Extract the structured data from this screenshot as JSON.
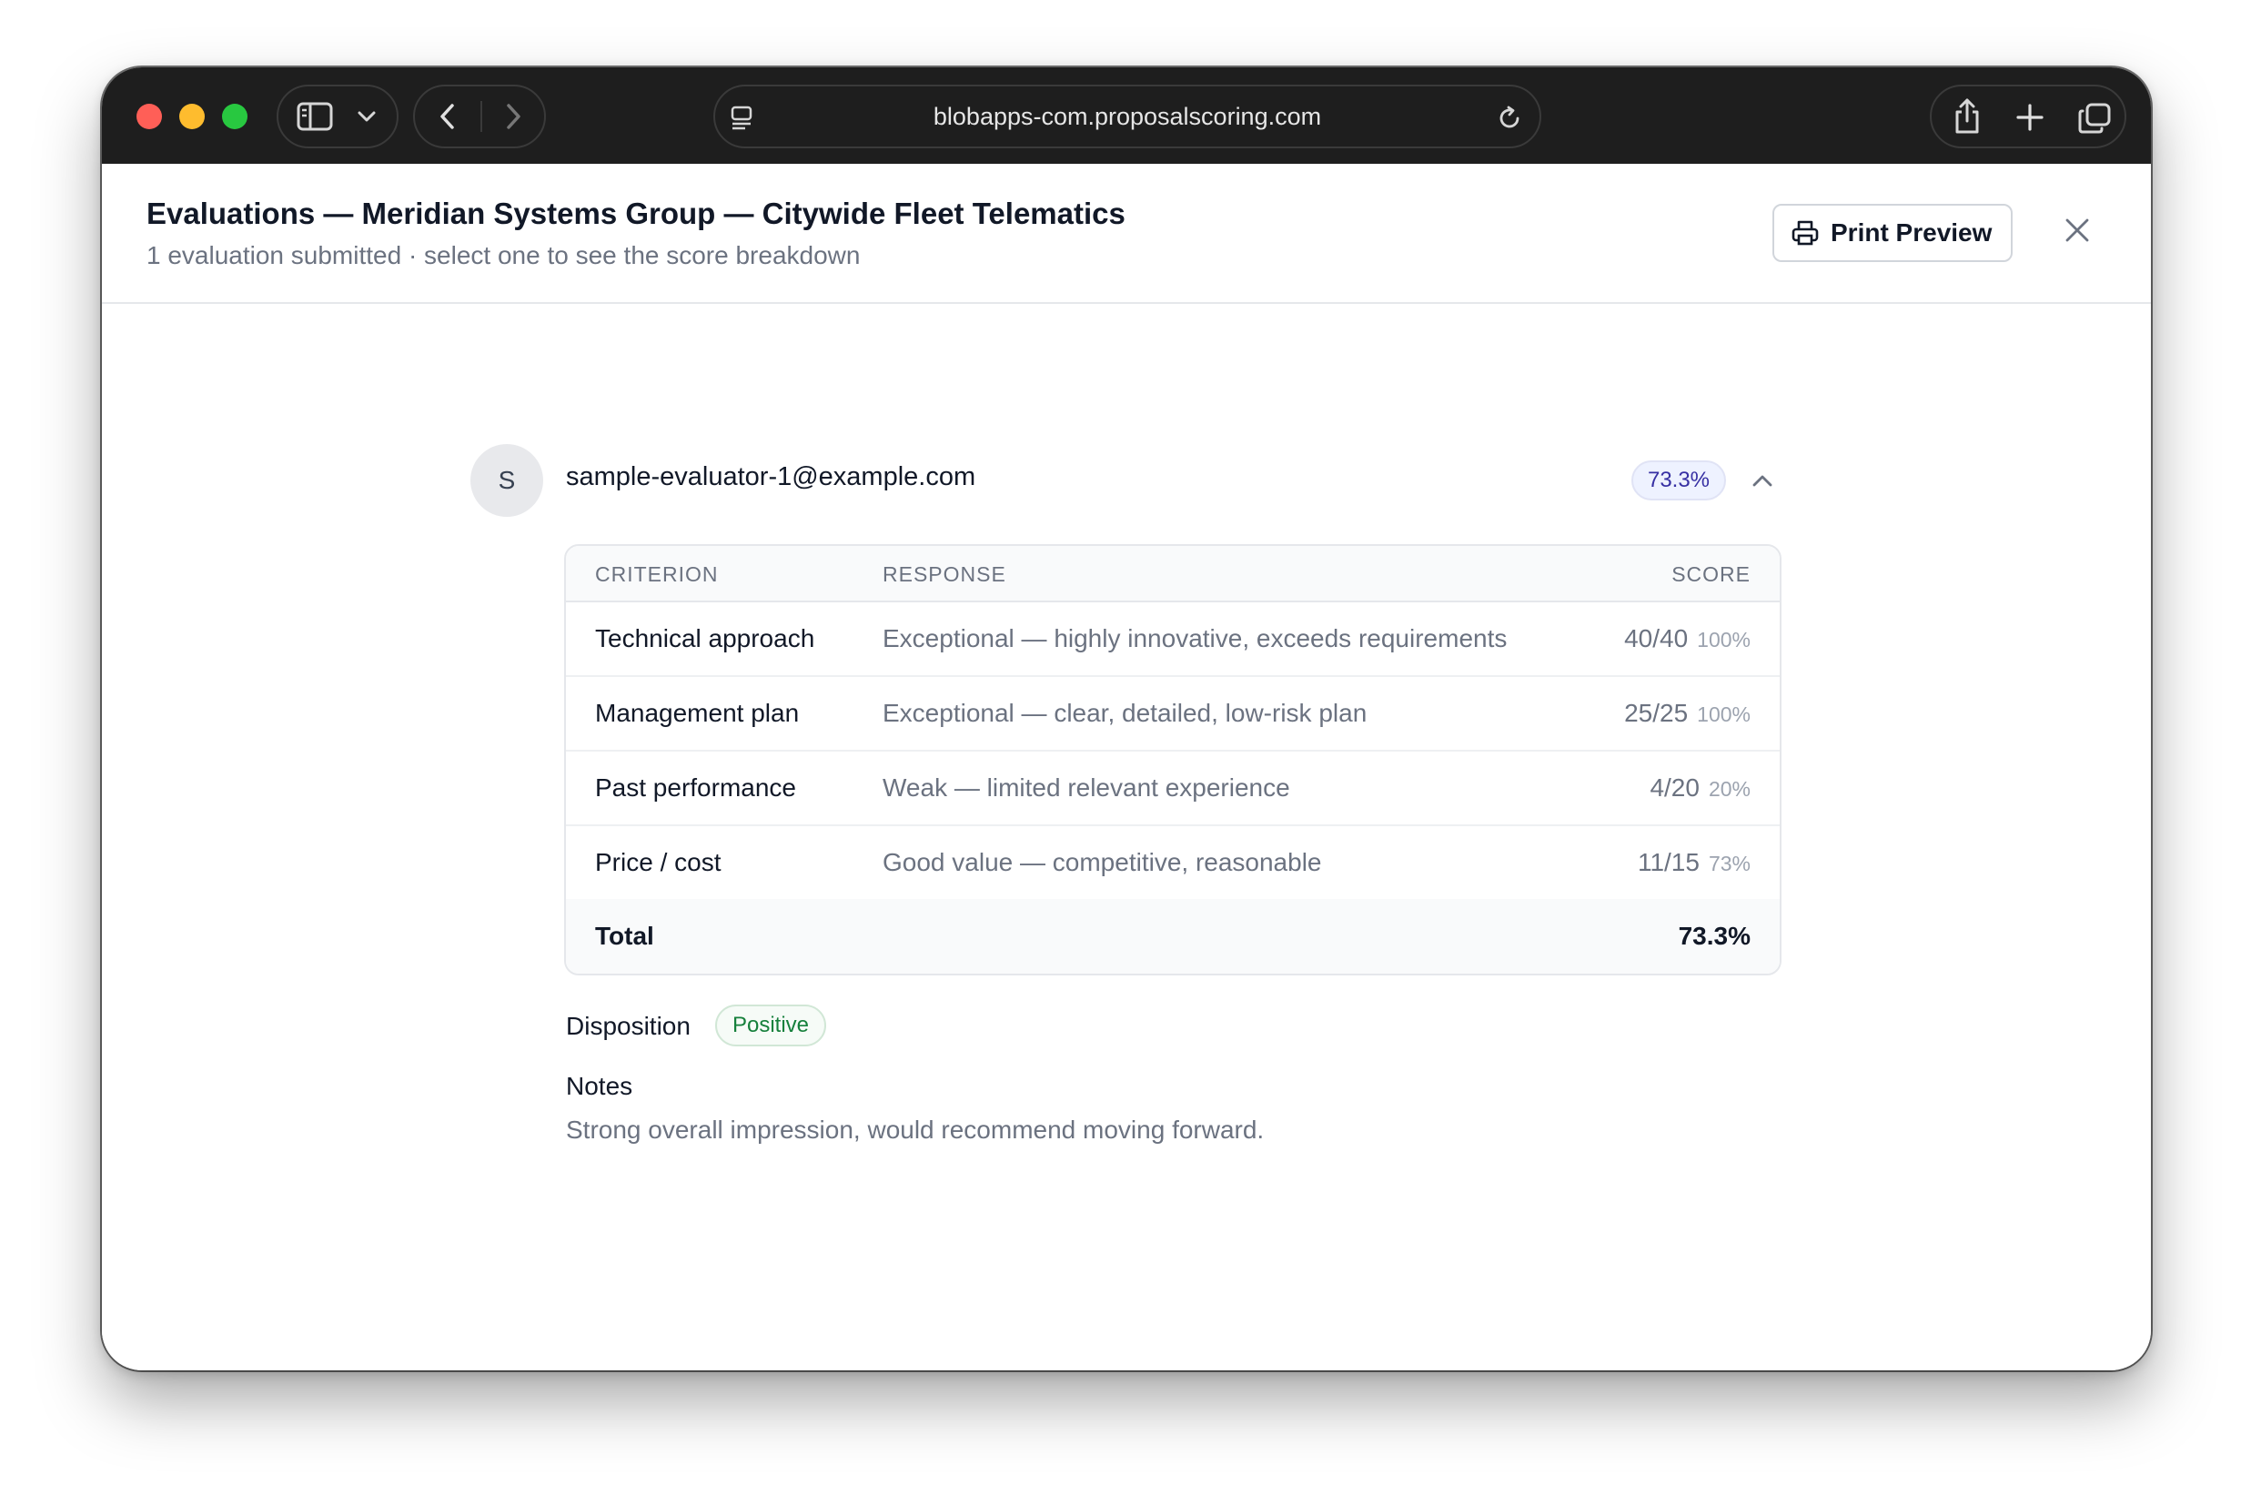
{
  "browser": {
    "url": "blobapps-com.proposalscoring.com",
    "icons": [
      "sidebar-icon",
      "chevron-down-icon",
      "back-icon",
      "forward-icon",
      "page-menu-icon",
      "reload-icon",
      "share-icon",
      "plus-icon",
      "tabs-icon"
    ]
  },
  "header": {
    "title": "Evaluations — Meridian Systems Group — Citywide Fleet Telematics",
    "subtitle": "1 evaluation submitted · select one to see the score breakdown",
    "print_label": "Print Preview"
  },
  "evaluation": {
    "avatar_initial": "S",
    "email": "sample-evaluator-1@example.com",
    "score_badge": "73.3%",
    "table": {
      "columns": [
        "CRITERION",
        "RESPONSE",
        "SCORE"
      ],
      "rows": [
        {
          "criterion": "Technical approach",
          "response": "Exceptional — highly innovative, exceeds requirements",
          "points": "40/40",
          "percent": "100%"
        },
        {
          "criterion": "Management plan",
          "response": "Exceptional — clear, detailed, low-risk plan",
          "points": "25/25",
          "percent": "100%"
        },
        {
          "criterion": "Past performance",
          "response": "Weak — limited relevant experience",
          "points": "4/20",
          "percent": "20%"
        },
        {
          "criterion": "Price / cost",
          "response": "Good value — competitive, reasonable",
          "points": "11/15",
          "percent": "73%"
        }
      ],
      "total_label": "Total",
      "total_value": "73.3%"
    },
    "disposition_label": "Disposition",
    "disposition_value": "Positive",
    "notes_label": "Notes",
    "notes_text": "Strong overall impression, would recommend moving forward."
  },
  "colors": {
    "titlebar": "#1e1e1e",
    "accent_badge": "#3730a3",
    "positive": "#16803c"
  }
}
